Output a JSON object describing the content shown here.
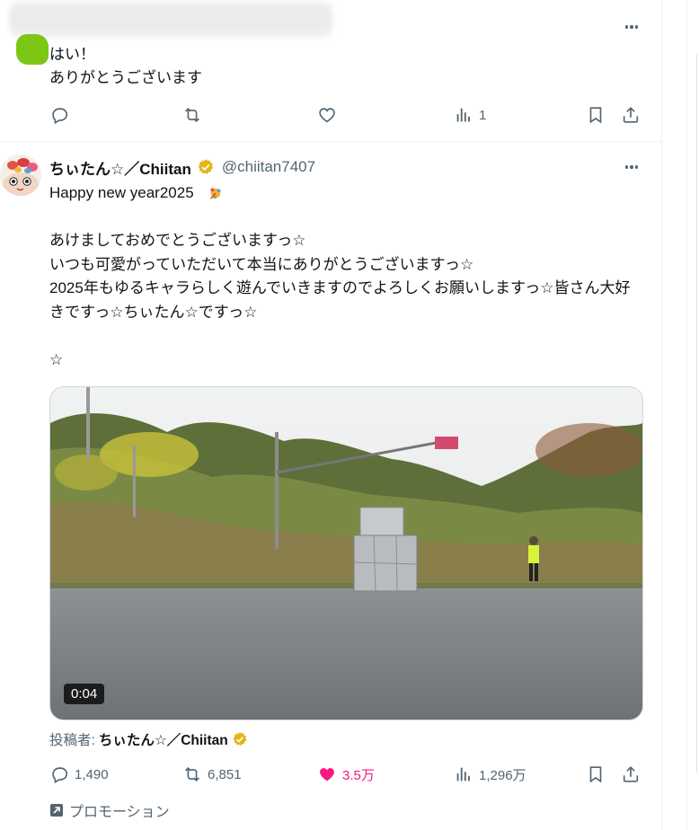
{
  "reply": {
    "text": "はい！\nありがとうございます",
    "actions": {
      "reply_count": "",
      "retweet_count": "",
      "like_count": "",
      "views_count": "1"
    }
  },
  "tweet": {
    "author_name": "ちぃたん☆／Chiitan",
    "handle": "@chiitan7407",
    "body": "Happy new year2025\n\nあけましておめでとうございますっ☆\nいつも可愛がっていただいて本当にありがとうございますっ☆\n2025年もゆるキャラらしく遊んでいきますのでよろしくお願いしますっ☆皆さん大好きですっ☆ちぃたん☆ですっ☆\n\n☆",
    "video_duration": "0:04",
    "poster_label": "投稿者:",
    "poster_name": "ちぃたん☆／Chiitan",
    "actions": {
      "reply_count": "1,490",
      "retweet_count": "6,851",
      "like_count": "3.5万",
      "views_count": "1,296万"
    },
    "promo_label": "プロモーション"
  },
  "colors": {
    "accent_like": "#f91880",
    "muted": "#536471",
    "verified_gold": "#e2b719"
  }
}
